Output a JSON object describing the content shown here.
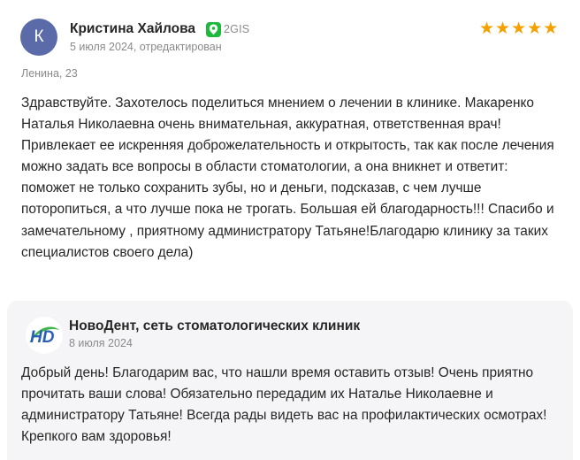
{
  "review": {
    "avatar_letter": "К",
    "author": "Кристина Хайлова",
    "source_icon": "2gis-pin-icon",
    "source": "2GIS",
    "date": "5 июля 2024, отредактирован",
    "rating": 5,
    "stars": [
      "★",
      "★",
      "★",
      "★",
      "★"
    ],
    "branch": "Ленина, 23",
    "text": "Здравствуйте. Захотелось поделиться мнением о лечении в клинике. Макаренко Наталья Николаевна очень внимательная, аккуратная, ответственная врач! Привлекает ее искренняя доброжелательность и открытость, так как после лечения можно задать все вопросы в области стоматологии, а она вникнет и ответит: поможет не только сохранить зубы, но и деньги, подсказав, с чем лучше поторопиться, а что лучше пока не трогать. Большая ей благодарность!!! Спасибо и замечательному , приятному администратору Татьяне!Благодарю клинику за таких специалистов своего дела)"
  },
  "reply": {
    "logo_icon": "novodent-logo",
    "author": "НовоДент, сеть стоматологических клиник",
    "date": "8 июля 2024",
    "text": "Добрый день! Благодарим вас, что нашли время оставить отзыв! Очень приятно прочитать ваши слова! Обязательно передадим их Наталье Николаевне и администратору Татьяне! Всегда рады видеть вас на профилактических осмотрах! Крепкого вам здоровья!"
  },
  "colors": {
    "avatar": "#5b6aa9",
    "star": "#f5a000",
    "gis_green": "#1db93c",
    "reply_background": "#f5f5f7",
    "logo_blue": "#2b5fb4",
    "logo_green": "#3cb54a",
    "muted_text": "#8a8a8a"
  }
}
